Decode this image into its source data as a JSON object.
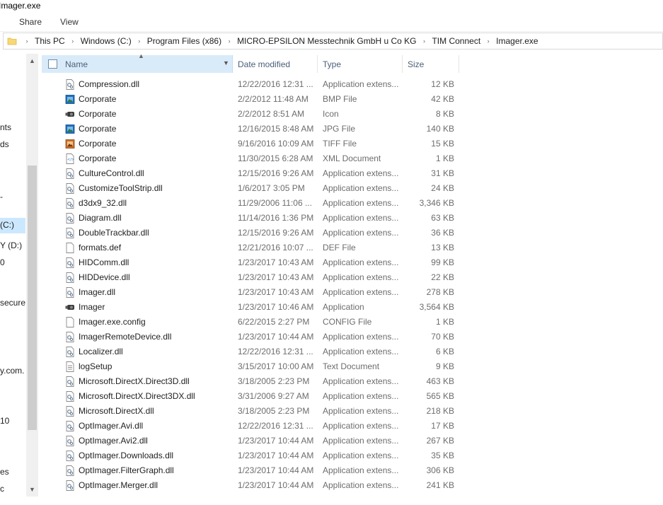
{
  "window": {
    "title": "Imager.exe"
  },
  "ribbon": {
    "tabs": [
      "Share",
      "View"
    ]
  },
  "address": {
    "crumbs": [
      "This PC",
      "Windows (C:)",
      "Program Files (x86)",
      "MICRO-EPSILON Messtechnik GmbH u Co KG",
      "TIM Connect",
      "Imager.exe"
    ]
  },
  "nav": {
    "items": [
      {
        "label": "nts",
        "selected": false
      },
      {
        "label": "ds",
        "selected": false
      },
      {
        "label": "-",
        "selected": false
      },
      {
        "label": "(C:)",
        "selected": true
      },
      {
        "label": "Y (D:)",
        "selected": false
      },
      {
        "label": "0",
        "selected": false
      },
      {
        "label": "secure",
        "selected": false
      },
      {
        "label": "y.com.",
        "selected": false
      },
      {
        "label": "10",
        "selected": false
      },
      {
        "label": "es",
        "selected": false
      },
      {
        "label": "c",
        "selected": false
      }
    ]
  },
  "columns": {
    "name": "Name",
    "date": "Date modified",
    "type": "Type",
    "size": "Size"
  },
  "files": [
    {
      "name": "Compression.dll",
      "date": "12/22/2016 12:31 ...",
      "type": "Application extens...",
      "size": "12 KB",
      "icon": "dll-icon"
    },
    {
      "name": "Corporate",
      "date": "2/2/2012 11:48 AM",
      "type": "BMP File",
      "size": "42 KB",
      "icon": "image-icon"
    },
    {
      "name": "Corporate",
      "date": "2/2/2012 8:51 AM",
      "type": "Icon",
      "size": "8 KB",
      "icon": "camera-icon"
    },
    {
      "name": "Corporate",
      "date": "12/16/2015 8:48 AM",
      "type": "JPG File",
      "size": "140 KB",
      "icon": "image-icon"
    },
    {
      "name": "Corporate",
      "date": "9/16/2016 10:09 AM",
      "type": "TIFF File",
      "size": "15 KB",
      "icon": "tiff-icon"
    },
    {
      "name": "Corporate",
      "date": "11/30/2015 6:28 AM",
      "type": "XML Document",
      "size": "1 KB",
      "icon": "xml-icon"
    },
    {
      "name": "CultureControl.dll",
      "date": "12/15/2016 9:26 AM",
      "type": "Application extens...",
      "size": "31 KB",
      "icon": "dll-icon"
    },
    {
      "name": "CustomizeToolStrip.dll",
      "date": "1/6/2017 3:05 PM",
      "type": "Application extens...",
      "size": "24 KB",
      "icon": "dll-icon"
    },
    {
      "name": "d3dx9_32.dll",
      "date": "11/29/2006 11:06 ...",
      "type": "Application extens...",
      "size": "3,346 KB",
      "icon": "dll-icon"
    },
    {
      "name": "Diagram.dll",
      "date": "11/14/2016 1:36 PM",
      "type": "Application extens...",
      "size": "63 KB",
      "icon": "dll-icon"
    },
    {
      "name": "DoubleTrackbar.dll",
      "date": "12/15/2016 9:26 AM",
      "type": "Application extens...",
      "size": "36 KB",
      "icon": "dll-icon"
    },
    {
      "name": "formats.def",
      "date": "12/21/2016 10:07 ...",
      "type": "DEF File",
      "size": "13 KB",
      "icon": "file-icon"
    },
    {
      "name": "HIDComm.dll",
      "date": "1/23/2017 10:43 AM",
      "type": "Application extens...",
      "size": "99 KB",
      "icon": "dll-icon"
    },
    {
      "name": "HIDDevice.dll",
      "date": "1/23/2017 10:43 AM",
      "type": "Application extens...",
      "size": "22 KB",
      "icon": "dll-icon"
    },
    {
      "name": "Imager.dll",
      "date": "1/23/2017 10:43 AM",
      "type": "Application extens...",
      "size": "278 KB",
      "icon": "dll-icon"
    },
    {
      "name": "Imager",
      "date": "1/23/2017 10:46 AM",
      "type": "Application",
      "size": "3,564 KB",
      "icon": "camera-icon"
    },
    {
      "name": "Imager.exe.config",
      "date": "6/22/2015 2:27 PM",
      "type": "CONFIG File",
      "size": "1 KB",
      "icon": "file-icon"
    },
    {
      "name": "ImagerRemoteDevice.dll",
      "date": "1/23/2017 10:44 AM",
      "type": "Application extens...",
      "size": "70 KB",
      "icon": "dll-icon"
    },
    {
      "name": "Localizer.dll",
      "date": "12/22/2016 12:31 ...",
      "type": "Application extens...",
      "size": "6 KB",
      "icon": "dll-icon"
    },
    {
      "name": "logSetup",
      "date": "3/15/2017 10:00 AM",
      "type": "Text Document",
      "size": "9 KB",
      "icon": "text-icon"
    },
    {
      "name": "Microsoft.DirectX.Direct3D.dll",
      "date": "3/18/2005 2:23 PM",
      "type": "Application extens...",
      "size": "463 KB",
      "icon": "dll-icon"
    },
    {
      "name": "Microsoft.DirectX.Direct3DX.dll",
      "date": "3/31/2006 9:27 AM",
      "type": "Application extens...",
      "size": "565 KB",
      "icon": "dll-icon"
    },
    {
      "name": "Microsoft.DirectX.dll",
      "date": "3/18/2005 2:23 PM",
      "type": "Application extens...",
      "size": "218 KB",
      "icon": "dll-icon"
    },
    {
      "name": "OptImager.Avi.dll",
      "date": "12/22/2016 12:31 ...",
      "type": "Application extens...",
      "size": "17 KB",
      "icon": "dll-icon"
    },
    {
      "name": "OptImager.Avi2.dll",
      "date": "1/23/2017 10:44 AM",
      "type": "Application extens...",
      "size": "267 KB",
      "icon": "dll-icon"
    },
    {
      "name": "OptImager.Downloads.dll",
      "date": "1/23/2017 10:44 AM",
      "type": "Application extens...",
      "size": "35 KB",
      "icon": "dll-icon"
    },
    {
      "name": "OptImager.FilterGraph.dll",
      "date": "1/23/2017 10:44 AM",
      "type": "Application extens...",
      "size": "306 KB",
      "icon": "dll-icon"
    },
    {
      "name": "OptImager.Merger.dll",
      "date": "1/23/2017 10:44 AM",
      "type": "Application extens...",
      "size": "241 KB",
      "icon": "dll-icon"
    }
  ],
  "colors": {
    "header_selected": "#d9ebf9",
    "nav_selected": "#cce8ff",
    "header_text": "#4c607a",
    "meta_text": "#6d6d6d"
  }
}
